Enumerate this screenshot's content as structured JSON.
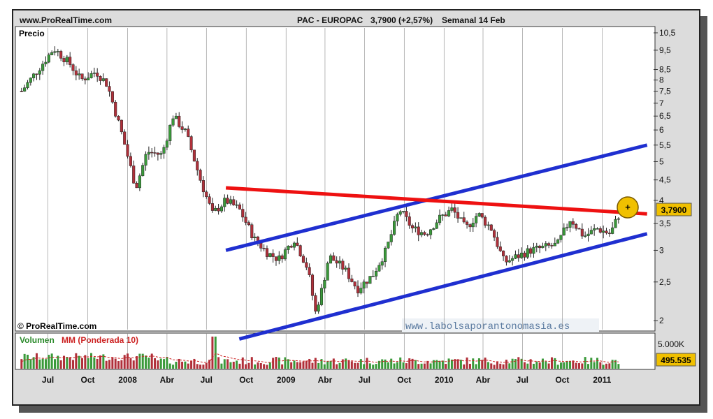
{
  "header": {
    "site": "www.ProRealTime.com",
    "instrument": "PAC - EUROPAC",
    "price_change": "3,7900 (+2,57%)",
    "period": "Semanal 14 Feb"
  },
  "price_panel": {
    "label": "Precio",
    "copyright": "© ProRealTime.com",
    "watermark": "www.labolsaporantonomasia.es",
    "last_price_badge": "3,7900"
  },
  "volume_panel": {
    "label_volumen": "Volumen",
    "label_mm": "MM (Ponderada 10)",
    "scale_label": "5.000K",
    "last_volume_badge": "495.535"
  },
  "colors": {
    "up_candle": "#3a9a3a",
    "down_candle": "#b0303a",
    "trend_channel": "#1f2fd0",
    "resistance": "#ee1111",
    "volume_ma": "#cc2222",
    "signal_marker": "#f0c000"
  },
  "chart_data": {
    "type": "candlestick",
    "scale": "log",
    "ylim": [
      1.9,
      10.8
    ],
    "y_ticks": [
      "10,5",
      "9,5",
      "8,5",
      "8",
      "7,5",
      "7",
      "6,5",
      "6",
      "5,5",
      "5",
      "4,5",
      "4",
      "3,5",
      "3",
      "2,5",
      "2"
    ],
    "x_ticks": [
      "Jul",
      "Oct",
      "2008",
      "Abr",
      "Jul",
      "Oct",
      "2009",
      "Abr",
      "Jul",
      "Oct",
      "2010",
      "Abr",
      "Jul",
      "Oct",
      "2011"
    ],
    "weekly_close_anchors": [
      [
        "2007-05-01",
        7.5
      ],
      [
        "2007-06-01",
        8.3
      ],
      [
        "2007-07-15",
        9.6
      ],
      [
        "2007-08-20",
        8.8
      ],
      [
        "2007-09-15",
        8.0
      ],
      [
        "2007-10-20",
        8.4
      ],
      [
        "2007-11-15",
        7.8
      ],
      [
        "2007-12-20",
        5.8
      ],
      [
        "2008-01-20",
        4.3
      ],
      [
        "2008-02-15",
        5.3
      ],
      [
        "2008-03-20",
        5.2
      ],
      [
        "2008-04-15",
        6.5
      ],
      [
        "2008-05-15",
        5.9
      ],
      [
        "2008-06-20",
        4.4
      ],
      [
        "2008-07-15",
        3.7
      ],
      [
        "2008-08-15",
        4.0
      ],
      [
        "2008-09-15",
        3.8
      ],
      [
        "2008-10-20",
        3.2
      ],
      [
        "2008-11-20",
        2.95
      ],
      [
        "2008-12-15",
        2.85
      ],
      [
        "2009-01-20",
        3.2
      ],
      [
        "2009-02-20",
        2.7
      ],
      [
        "2009-03-10",
        2.1
      ],
      [
        "2009-03-25",
        2.4
      ],
      [
        "2009-04-10",
        2.9
      ],
      [
        "2009-05-15",
        2.7
      ],
      [
        "2009-06-15",
        2.4
      ],
      [
        "2009-07-20",
        2.6
      ],
      [
        "2009-08-20",
        3.0
      ],
      [
        "2009-09-20",
        3.8
      ],
      [
        "2009-10-20",
        3.4
      ],
      [
        "2009-11-20",
        3.3
      ],
      [
        "2009-12-20",
        3.6
      ],
      [
        "2010-01-20",
        3.8
      ],
      [
        "2010-02-20",
        3.4
      ],
      [
        "2010-03-20",
        3.7
      ],
      [
        "2010-04-20",
        3.4
      ],
      [
        "2010-05-20",
        2.8
      ],
      [
        "2010-06-20",
        2.9
      ],
      [
        "2010-07-20",
        3.0
      ],
      [
        "2010-08-20",
        3.05
      ],
      [
        "2010-09-20",
        3.1
      ],
      [
        "2010-10-20",
        3.6
      ],
      [
        "2010-11-20",
        3.25
      ],
      [
        "2010-12-20",
        3.4
      ],
      [
        "2011-01-20",
        3.3
      ],
      [
        "2011-02-14",
        3.79
      ]
    ],
    "trendlines": [
      {
        "name": "channel_upper",
        "points": [
          [
            "2008-08-15",
            3.0
          ],
          [
            "2011-04-15",
            5.5
          ]
        ]
      },
      {
        "name": "channel_lower",
        "points": [
          [
            "2008-09-15",
            1.8
          ],
          [
            "2011-04-15",
            3.3
          ]
        ]
      },
      {
        "name": "resistance",
        "points": [
          [
            "2008-08-15",
            4.3
          ],
          [
            "2011-04-15",
            3.7
          ]
        ]
      }
    ],
    "volume_scale": "5.000K",
    "last_volume": 495535
  }
}
